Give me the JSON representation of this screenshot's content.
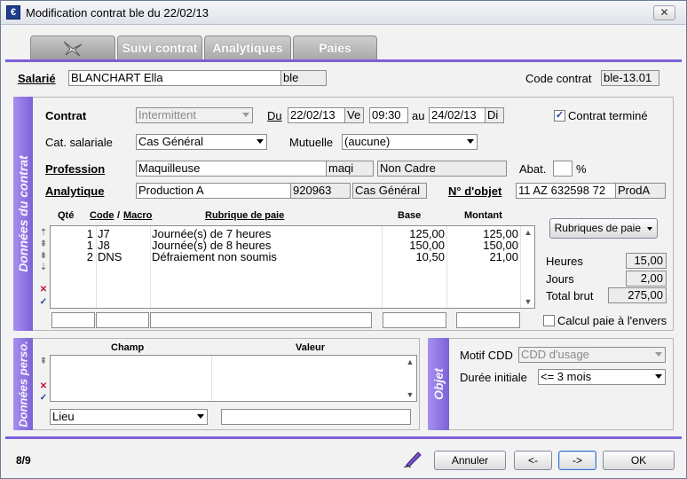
{
  "window": {
    "title": "Modification contrat ble du 22/02/13",
    "close_label": "✕"
  },
  "tabs": [
    {
      "label": ""
    },
    {
      "label": "Suivi contrat"
    },
    {
      "label": "Analytiques"
    },
    {
      "label": "Paies"
    }
  ],
  "header": {
    "salarie_label": "Salarié",
    "salarie_name": "BLANCHART Ella",
    "salarie_code": "ble",
    "code_contrat_label": "Code contrat",
    "code_contrat_value": "ble-13.01"
  },
  "contract": {
    "band_label": "Données du contrat",
    "contrat_label": "Contrat",
    "contrat_value": "Intermittent",
    "du_label": "Du",
    "du_date": "22/02/13",
    "du_day": "Ve",
    "du_time": "09:30",
    "au_label": "au",
    "au_date": "24/02/13",
    "au_day": "Di",
    "termine_label": "Contrat terminé",
    "termine_checked": "✓",
    "cat_label": "Cat. salariale",
    "cat_value": "Cas Général",
    "mutuelle_label": "Mutuelle",
    "mutuelle_value": "(aucune)",
    "profession_label": "Profession",
    "profession_value": "Maquilleuse",
    "profession_code": "maqi",
    "profession_status": "Non Cadre",
    "abat_label": "Abat.",
    "abat_value": "",
    "percent_label": "%",
    "analytique_label": "Analytique",
    "analytique_value": "Production A",
    "analytique_code": "920963",
    "analytique_cat": "Cas Général",
    "objet_label": "N° d'objet",
    "objet_value": "11 AZ 632598 72",
    "objet_code": "ProdA"
  },
  "paie_grid": {
    "headers": {
      "qte": "Qté",
      "code": "Code",
      "slash": "/",
      "macro": "Macro",
      "rubrique": "Rubrique de paie",
      "base": "Base",
      "montant": "Montant"
    },
    "rows": [
      {
        "qte": "1",
        "code": "J7",
        "rubrique": "Journée(s) de 7 heures",
        "base": "125,00",
        "montant": "125,00"
      },
      {
        "qte": "1",
        "code": "J8",
        "rubrique": "Journée(s) de 8 heures",
        "base": "150,00",
        "montant": "150,00"
      },
      {
        "qte": "2",
        "code": "DNS",
        "rubrique": "Défraiement non soumis",
        "base": "10,50",
        "montant": "21,00"
      }
    ],
    "rubriques_button": "Rubriques de paie"
  },
  "totals": {
    "heures_label": "Heures",
    "heures_value": "15,00",
    "jours_label": "Jours",
    "jours_value": "2,00",
    "brut_label": "Total brut",
    "brut_value": "275,00",
    "calcul_label": "Calcul paie à l'envers"
  },
  "perso": {
    "band_label": "Données perso.",
    "champ_header": "Champ",
    "valeur_header": "Valeur",
    "lieu_value": "Lieu",
    "valeur_input": ""
  },
  "objet_panel": {
    "band_label": "Objet",
    "motif_label": "Motif CDD",
    "motif_value": "CDD d'usage",
    "duree_label": "Durée initiale",
    "duree_value": "<= 3 mois"
  },
  "footer": {
    "page": "8/9",
    "annuler": "Annuler",
    "prev": "<-",
    "next": "->",
    "ok": "OK"
  },
  "colors": {
    "accent": "#7d5fd9",
    "check": "#21409a",
    "delete": "#c8102e"
  }
}
